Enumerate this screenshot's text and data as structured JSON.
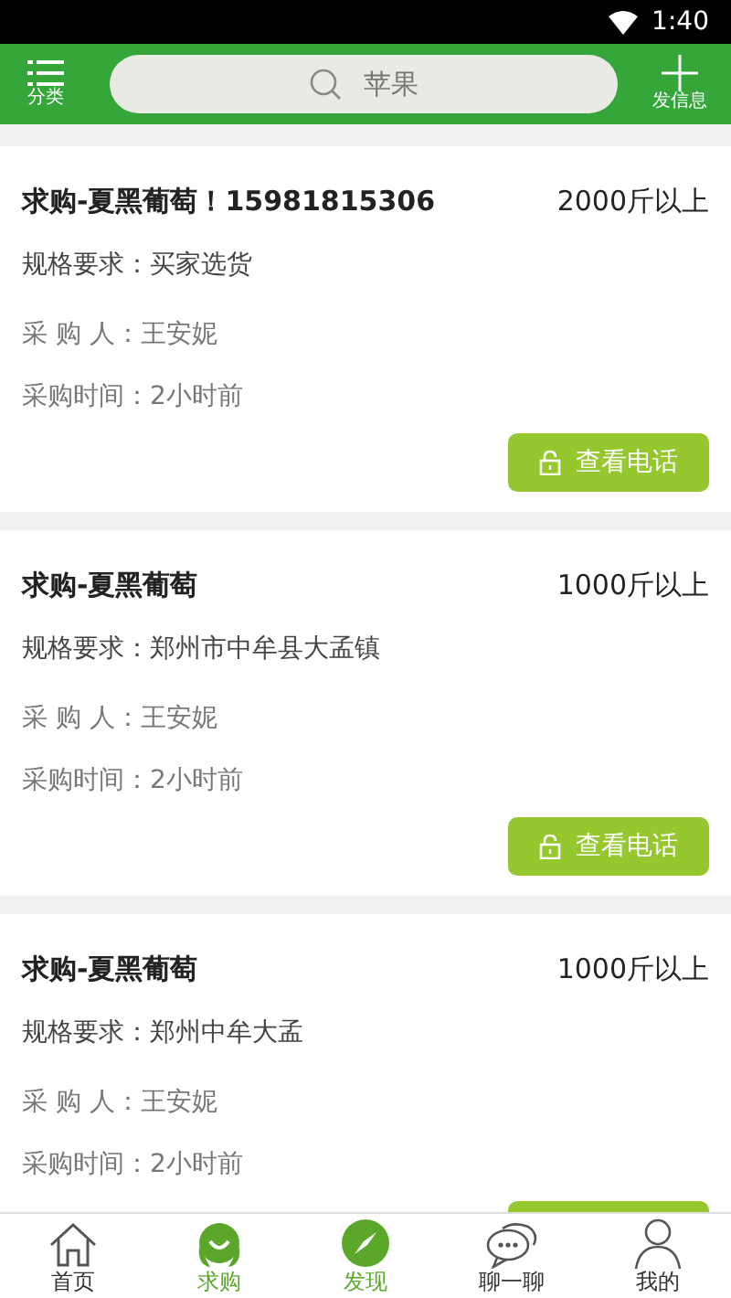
{
  "status_bar": {
    "time": "1:40"
  },
  "header": {
    "menu_label": "分类",
    "search_value": "苹果",
    "post_label": "发信息"
  },
  "cards": [
    {
      "title": "求购-夏黑葡萄！15981815306",
      "quantity": "2000斤以上",
      "rows": [
        {
          "label": "规格要求：",
          "value": "买家选货"
        },
        {
          "label": "采 购 人：",
          "value": "王安妮"
        },
        {
          "label": "采购时间：",
          "value": "2小时前"
        }
      ],
      "button": true,
      "button_label": "查看电话"
    },
    {
      "title": "求购-夏黑葡萄",
      "quantity": "1000斤以上",
      "rows": [
        {
          "label": "规格要求：",
          "value": "郑州市中牟县大孟镇"
        },
        {
          "label": "采 购 人：",
          "value": "王安妮"
        },
        {
          "label": "采购时间：",
          "value": "2小时前"
        }
      ],
      "button": true,
      "button_label": "查看电话"
    },
    {
      "title": "求购-夏黑葡萄",
      "quantity": "1000斤以上",
      "rows": [
        {
          "label": "规格要求：",
          "value": "郑州中牟大孟"
        },
        {
          "label": "采 购 人：",
          "value": "王安妮"
        },
        {
          "label": "采购时间：",
          "value": "2小时前"
        }
      ],
      "button": true
    }
  ],
  "tabs": [
    {
      "label": "首页",
      "kind": "home",
      "selected": false
    },
    {
      "label": "求购",
      "kind": "buy",
      "selected": true
    },
    {
      "label": "发现",
      "kind": "discover",
      "selected": true
    },
    {
      "label": "聊一聊",
      "kind": "chat",
      "selected": false
    },
    {
      "label": "我的",
      "kind": "me",
      "selected": false
    }
  ]
}
